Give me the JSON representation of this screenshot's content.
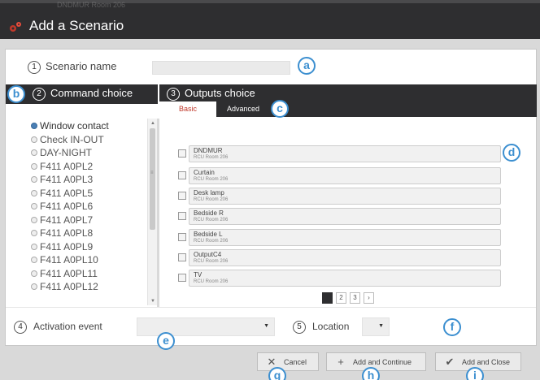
{
  "window": {
    "title": "Add a Scenario",
    "background_text": "DNDMUR Room 206"
  },
  "scenario_name": {
    "step": "1",
    "label": "Scenario name",
    "value": ""
  },
  "command_choice": {
    "step": "2",
    "label": "Command choice",
    "items": [
      {
        "label": "Window contact",
        "selected": true
      },
      {
        "label": "Check IN-OUT",
        "selected": false
      },
      {
        "label": "DAY-NIGHT",
        "selected": false
      },
      {
        "label": "F411 A0PL2",
        "selected": false
      },
      {
        "label": "F411 A0PL3",
        "selected": false
      },
      {
        "label": "F411 A0PL5",
        "selected": false
      },
      {
        "label": "F411 A0PL6",
        "selected": false
      },
      {
        "label": "F411 A0PL7",
        "selected": false
      },
      {
        "label": "F411 A0PL8",
        "selected": false
      },
      {
        "label": "F411 A0PL9",
        "selected": false
      },
      {
        "label": "F411 A0PL10",
        "selected": false
      },
      {
        "label": "F411 A0PL11",
        "selected": false
      },
      {
        "label": "F411 A0PL12",
        "selected": false
      }
    ]
  },
  "outputs_choice": {
    "step": "3",
    "label": "Outputs choice",
    "tabs": [
      {
        "label": "Basic",
        "active": true
      },
      {
        "label": "Advanced",
        "active": false
      }
    ],
    "items": [
      {
        "name": "DNDMUR",
        "room": "RCU Room 206"
      },
      {
        "name": "Curtain",
        "room": "RCU Room 206"
      },
      {
        "name": "Desk lamp",
        "room": "RCU Room 206"
      },
      {
        "name": "Bedside R",
        "room": "RCU Room 206"
      },
      {
        "name": "Bedside L",
        "room": "RCU Room 206"
      },
      {
        "name": "OutputC4",
        "room": "RCU Room 206"
      },
      {
        "name": "TV",
        "room": "RCU Room 206"
      }
    ],
    "pager": {
      "pages": [
        "1",
        "2",
        "3"
      ],
      "current": "1",
      "next": "›"
    }
  },
  "activation_event": {
    "step": "4",
    "label": "Activation event",
    "value": ""
  },
  "location": {
    "step": "5",
    "label": "Location",
    "value": ""
  },
  "buttons": {
    "cancel": "Cancel",
    "add_continue": "Add and Continue",
    "add_close": "Add and Close"
  },
  "icons": {
    "cancel": "close-icon",
    "add_continue": "plus-icon",
    "add_close": "check-icon",
    "dropdown": "caret-down-icon"
  },
  "callouts": [
    "a",
    "b",
    "c",
    "d",
    "e",
    "f",
    "g",
    "h",
    "i"
  ],
  "colors": {
    "header_dark": "#2e2e30",
    "accent_red": "#c0392b",
    "callout_blue": "#3c8fd0",
    "radio_selected": "#4a7fb5"
  }
}
